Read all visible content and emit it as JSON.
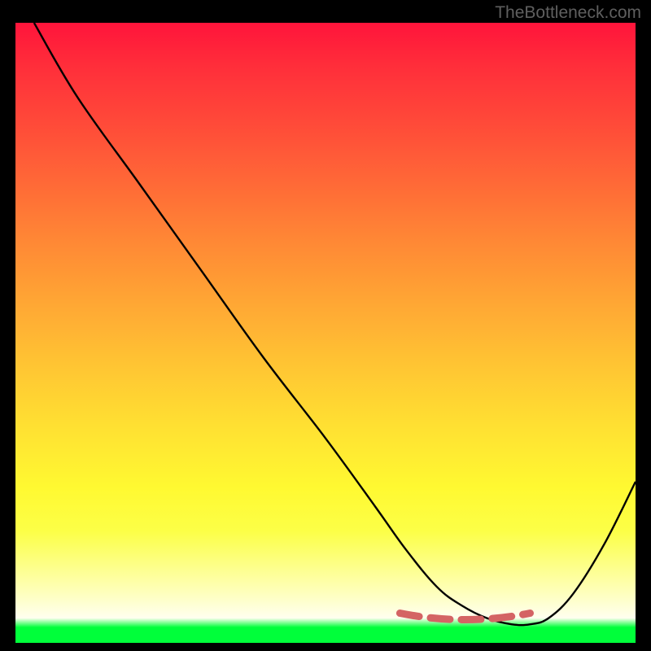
{
  "watermark": "TheBottleneck.com",
  "colors": {
    "background": "#000000",
    "curve": "#000000",
    "dash": "#d46464",
    "watermark_text": "#5f5f5f"
  },
  "chart_data": {
    "type": "line",
    "title": "",
    "xlabel": "",
    "ylabel": "",
    "xlim": [
      0,
      100
    ],
    "ylim": [
      0,
      100
    ],
    "grid": false,
    "series": [
      {
        "name": "bottleneck-curve",
        "x": [
          3,
          10,
          20,
          30,
          40,
          50,
          58,
          63,
          68,
          72,
          76,
          80,
          83,
          86,
          90,
          95,
          100
        ],
        "values": [
          100,
          88,
          74,
          60,
          46,
          33,
          22,
          15,
          9,
          6,
          4,
          3,
          3,
          4,
          8,
          16,
          26
        ]
      }
    ],
    "optimal_band": {
      "x_start": 62,
      "x_end": 83,
      "y": 4
    }
  }
}
